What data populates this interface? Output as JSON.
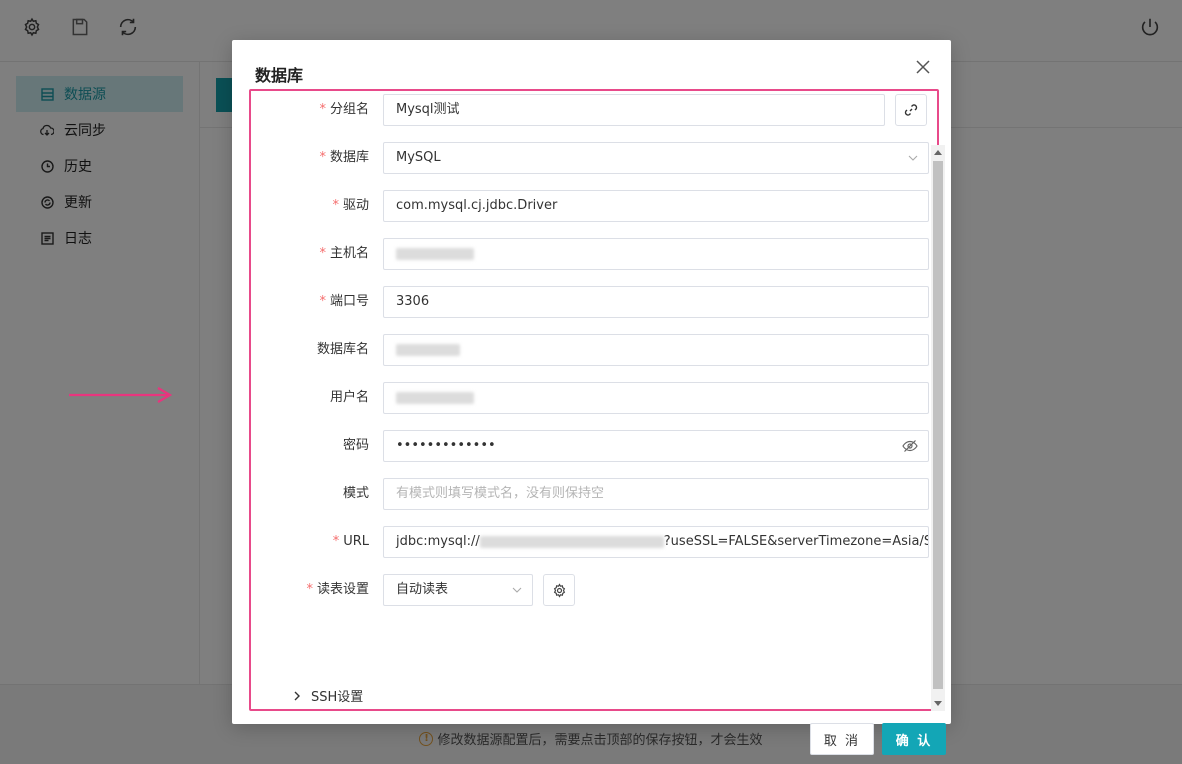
{
  "toolbar": {
    "icons": [
      "gear-icon",
      "save-icon",
      "refresh-icon",
      "power-icon"
    ]
  },
  "sidebar": {
    "items": [
      {
        "label": "数据源",
        "icon": "list-icon",
        "active": true
      },
      {
        "label": "云同步",
        "icon": "cloud-sync-icon",
        "active": false
      },
      {
        "label": "历史",
        "icon": "clock-icon",
        "active": false
      },
      {
        "label": "更新",
        "icon": "update-icon",
        "active": false
      },
      {
        "label": "日志",
        "icon": "log-icon",
        "active": false
      }
    ]
  },
  "footer": {
    "note": "修改数据源配置后，需要点击顶部的保存按钮，才会生效"
  },
  "modal": {
    "title": "数据库",
    "fields": {
      "group": {
        "label": "分组名",
        "value": "Mysql测试",
        "required": true
      },
      "database": {
        "label": "数据库",
        "value": "MySQL",
        "required": true
      },
      "driver": {
        "label": "驱动",
        "value": "com.mysql.cj.jdbc.Driver",
        "required": true
      },
      "host": {
        "label": "主机名",
        "required": true
      },
      "port": {
        "label": "端口号",
        "value": "3306",
        "required": true
      },
      "dbname": {
        "label": "数据库名",
        "required": false
      },
      "username": {
        "label": "用户名",
        "required": false
      },
      "password": {
        "label": "密码",
        "value": "•••••••••••••",
        "required": false
      },
      "schema": {
        "label": "模式",
        "placeholder": "有模式则填写模式名，没有则保持空",
        "required": false
      },
      "url": {
        "label": "URL",
        "prefix": "jdbc:mysql://",
        "suffix": "?useSSL=FALSE&serverTimezone=Asia/Sha",
        "required": true
      },
      "read_table": {
        "label": "读表设置",
        "value": "自动读表",
        "required": true
      }
    },
    "ssh_label": "SSH设置",
    "cancel_label": "取 消",
    "confirm_label": "确 认"
  },
  "colors": {
    "accent": "#13a6b6",
    "highlight": "#e84a8a",
    "required": "#f56c6c"
  }
}
